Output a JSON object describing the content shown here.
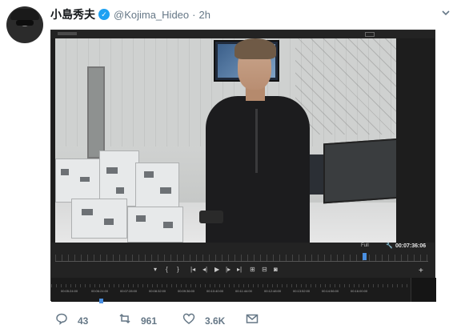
{
  "tweet": {
    "display_name": "小島秀夫",
    "verified_mark": "✓",
    "handle": "@Kojima_Hideo",
    "separator": "·",
    "time": "2h",
    "caret_icon": "chevron-down-icon"
  },
  "media": {
    "program_monitor": {
      "fit_label": "Full",
      "timecode": "00:07:36:06",
      "timeline_labels": [
        "00:05:24:00",
        "00:06:24:00",
        "00:07:28:00",
        "00:08:32:00",
        "00:09:36:00",
        "00:10:40:00",
        "00:11:44:00",
        "00:12:48:00",
        "00:13:52:00",
        "00:14:56:00",
        "00:16:00:00"
      ],
      "plus_button": "+"
    }
  },
  "actions": {
    "reply_count": "43",
    "retweet_count": "961",
    "like_count": "3.6K",
    "reply_icon": "reply-icon",
    "retweet_icon": "retweet-icon",
    "like_icon": "heart-icon",
    "dm_icon": "envelope-icon"
  },
  "colors": {
    "accent": "#1da1f2",
    "text_primary": "#14171a",
    "text_secondary": "#657786",
    "editor_bg": "#232323",
    "playhead": "#4a90e2"
  }
}
